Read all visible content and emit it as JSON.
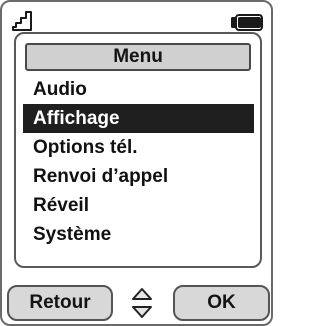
{
  "status_bar": {
    "signal_icon": "signal-strength-icon",
    "battery_icon": "battery-icon"
  },
  "menu": {
    "title": "Menu",
    "items": [
      {
        "label": "Audio"
      },
      {
        "label": "Affichage"
      },
      {
        "label": "Options tél."
      },
      {
        "label": "Renvoi d’appel"
      },
      {
        "label": "Réveil"
      },
      {
        "label": "Système"
      }
    ],
    "selected_index": 1
  },
  "softkeys": {
    "left_label": "Retour",
    "right_label": "OK",
    "nav_icon": "up-down-arrows-icon"
  },
  "colors": {
    "selection_bg": "#1f1f1f",
    "title_bg": "#d0d0d0",
    "softkey_bg": "#d8d8d8"
  }
}
